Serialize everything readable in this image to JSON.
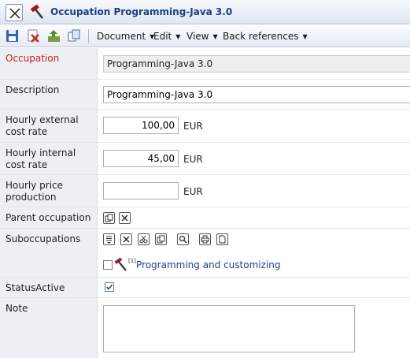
{
  "window": {
    "title": "Occupation Programming-Java 3.0"
  },
  "toolbar": {
    "menus": [
      {
        "label": "Document"
      },
      {
        "label": "Edit"
      },
      {
        "label": "View"
      },
      {
        "label": "Back references"
      }
    ]
  },
  "form": {
    "occupation": {
      "label": "Occupation",
      "value": "Programming-Java 3.0"
    },
    "description": {
      "label": "Description",
      "value": "Programming-Java 3.0"
    },
    "hourly_external": {
      "label": "Hourly external cost rate",
      "value": "100,00",
      "unit": "EUR"
    },
    "hourly_internal": {
      "label": "Hourly internal cost rate",
      "value": "45,00",
      "unit": "EUR"
    },
    "hourly_price": {
      "label": "Hourly price production",
      "value": "",
      "unit": "EUR"
    },
    "parent_occupation": {
      "label": "Parent occupation"
    },
    "suboccupations": {
      "label": "Suboccupations",
      "items": [
        {
          "marker": "[1]",
          "label": "Programming and customizing",
          "checked": false
        }
      ]
    },
    "status_active": {
      "label": "StatusActive",
      "checked": true
    },
    "note": {
      "label": "Note",
      "value": ""
    }
  },
  "colors": {
    "title_text": "#1a3f8a",
    "required_label": "#d01e1e",
    "link": "#1a3f9e",
    "label_bg": "#eceff3"
  }
}
